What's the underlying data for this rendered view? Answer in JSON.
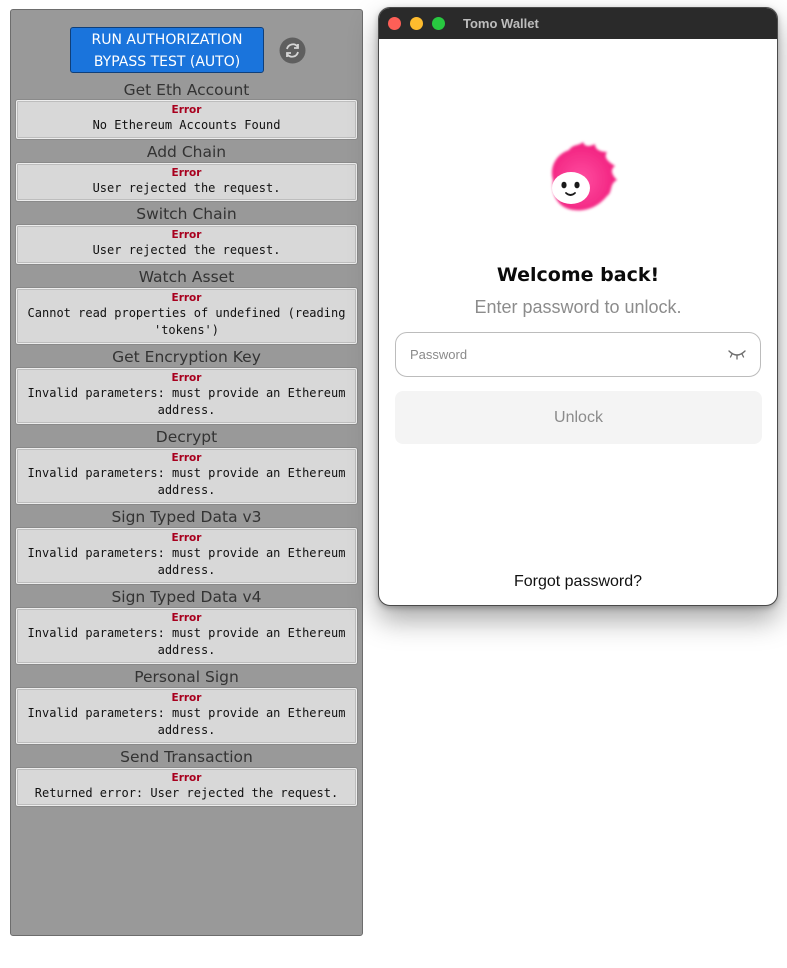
{
  "test_panel": {
    "run_button_label": "RUN AUTHORIZATION\nBYPASS TEST (AUTO)",
    "refresh_icon": "refresh-icon",
    "sections": [
      {
        "title": "Get Eth Account",
        "status": "Error",
        "message": "No Ethereum Accounts Found"
      },
      {
        "title": "Add Chain",
        "status": "Error",
        "message": "User rejected the request."
      },
      {
        "title": "Switch Chain",
        "status": "Error",
        "message": "User rejected the request."
      },
      {
        "title": "Watch Asset",
        "status": "Error",
        "message": "Cannot read properties of undefined (reading 'tokens')"
      },
      {
        "title": "Get Encryption Key",
        "status": "Error",
        "message": "Invalid parameters: must provide an Ethereum address."
      },
      {
        "title": "Decrypt",
        "status": "Error",
        "message": "Invalid parameters: must provide an Ethereum address."
      },
      {
        "title": "Sign Typed Data v3",
        "status": "Error",
        "message": "Invalid parameters: must provide an Ethereum address."
      },
      {
        "title": "Sign Typed Data v4",
        "status": "Error",
        "message": "Invalid parameters: must provide an Ethereum address."
      },
      {
        "title": "Personal Sign",
        "status": "Error",
        "message": "Invalid parameters: must provide an Ethereum address."
      },
      {
        "title": "Send Transaction",
        "status": "Error",
        "message": "Returned error: User rejected the request."
      }
    ]
  },
  "wallet": {
    "window_title": "Tomo Wallet",
    "logo_icon": "tomo-mascot-logo",
    "heading": "Welcome back!",
    "subtitle": "Enter password to unlock.",
    "password_placeholder": "Password",
    "password_value": "",
    "toggle_visibility_icon": "eye-closed-icon",
    "unlock_label": "Unlock",
    "forgot_label": "Forgot password?"
  },
  "colors": {
    "run_button": "#1a74dc",
    "error_text": "#a8001e",
    "panel_bg": "#999999",
    "brand_pink": "#ff2d8a"
  }
}
